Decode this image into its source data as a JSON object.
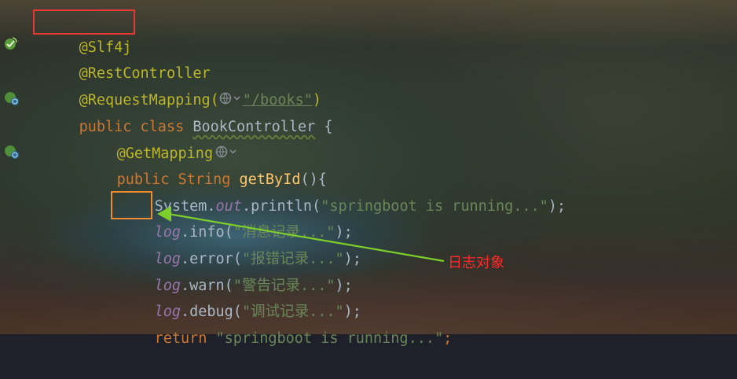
{
  "code_lines": {
    "l1": "@Slf4j",
    "l2": "@RestController",
    "l3_anno": "@RequestMapping(",
    "l3_url": "\"/books\"",
    "l3_close": ")",
    "l4_kw": "public class ",
    "l4_cls": "BookController",
    "l4_brace": " {",
    "l5": "@GetMapping",
    "l6_kw": "public ",
    "l6_type": "String ",
    "l6_method": "getById",
    "l6_rest": "(){",
    "l7_a": "System.",
    "l7_out": "out",
    "l7_b": ".println(",
    "l7_str": "\"springboot is running...\"",
    "l7_c": ");",
    "l8_log": "log",
    "l8_a": ".info(",
    "l8_str": "\"消息记录...\"",
    "l8_c": ");",
    "l9_log": "log",
    "l9_a": ".error(",
    "l9_str": "\"报错记录...\"",
    "l9_c": ");",
    "l10_log": "log",
    "l10_a": ".warn(",
    "l10_str": "\"警告记录...\"",
    "l10_c": ");",
    "l11_log": "log",
    "l11_a": ".debug(",
    "l11_str": "\"调试记录...\"",
    "l11_c": ");",
    "l12_kw": "return ",
    "l12_str": "\"springboot is running...\"",
    "l12_c": ";"
  },
  "annotation": {
    "callout_text": "日志对象"
  },
  "gutter": {
    "icons": [
      "bean-check-icon",
      "bean-globe-icon",
      "bean-globe-icon"
    ]
  },
  "colors": {
    "annotation": "#bbb529",
    "keyword": "#cc7832",
    "string": "#6a8759",
    "method": "#ffc66d",
    "field": "#9876aa",
    "highlight_red": "#e53935",
    "highlight_orange": "#ef8a2f",
    "arrow": "#7ccf2a"
  }
}
